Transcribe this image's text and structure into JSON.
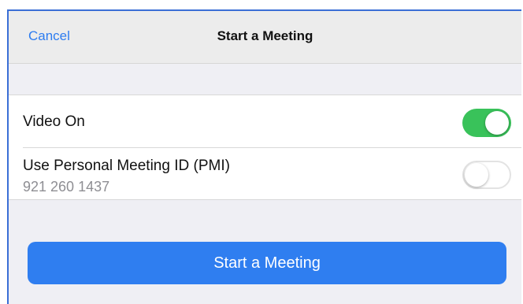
{
  "navbar": {
    "cancel_label": "Cancel",
    "title": "Start a Meeting"
  },
  "options": {
    "video_label": "Video On",
    "video_state": "on",
    "pmi_label": "Use Personal Meeting ID (PMI)",
    "pmi_id": "921 260 1437",
    "pmi_state": "off"
  },
  "start_button_label": "Start a Meeting",
  "colors": {
    "accent": "#2f7ef0",
    "toggle_on": "#39c25a",
    "background": "#efeff4"
  }
}
